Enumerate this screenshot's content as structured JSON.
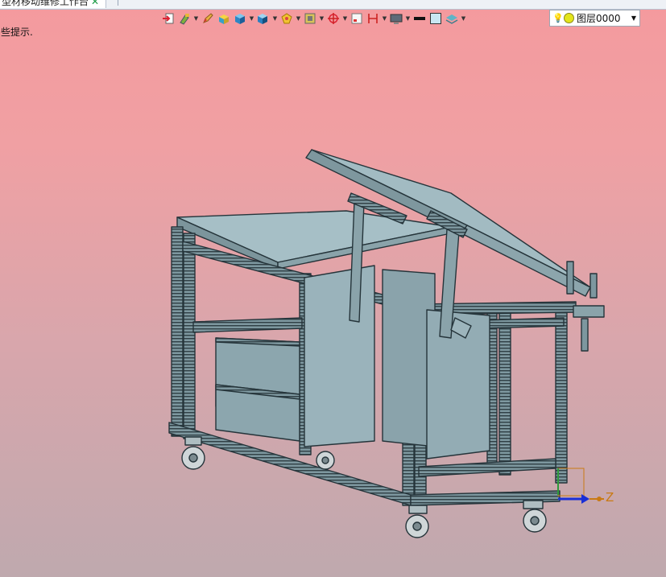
{
  "document_tab": {
    "title": "型材移动维修工作台",
    "close_glyph": "✕"
  },
  "status_hint": "些提示.",
  "toolbar": {
    "items": [
      {
        "icon": "insert-icon",
        "dropdown": false
      },
      {
        "icon": "paint-icon",
        "dropdown": true
      },
      {
        "icon": "pencil-icon",
        "dropdown": false
      },
      {
        "icon": "box-face-icon",
        "dropdown": false
      },
      {
        "icon": "cube-icon",
        "dropdown": true
      },
      {
        "icon": "render-mode-icon",
        "dropdown": true
      },
      {
        "icon": "section-view-icon",
        "dropdown": true
      },
      {
        "icon": "frame-icon",
        "dropdown": true
      },
      {
        "icon": "crosshair-icon",
        "dropdown": true
      },
      {
        "icon": "view-window-icon",
        "dropdown": false
      },
      {
        "icon": "measure-icon",
        "dropdown": true
      },
      {
        "icon": "display-icon",
        "dropdown": true
      },
      {
        "icon": "line-style-icon",
        "dropdown": false
      },
      {
        "icon": "color-swatch-icon",
        "dropdown": false
      },
      {
        "icon": "layers-icon",
        "dropdown": true
      }
    ]
  },
  "layer": {
    "value": "图层0000",
    "bulb_icon": "lightbulb-icon",
    "dot_color": "#e3e51a"
  },
  "triad": {
    "axis_label": "Z"
  },
  "colors": {
    "frame": "#6d8891",
    "frame_dark": "#35474e",
    "panel": "#9ab4bd",
    "top": "#a4bcc3"
  }
}
